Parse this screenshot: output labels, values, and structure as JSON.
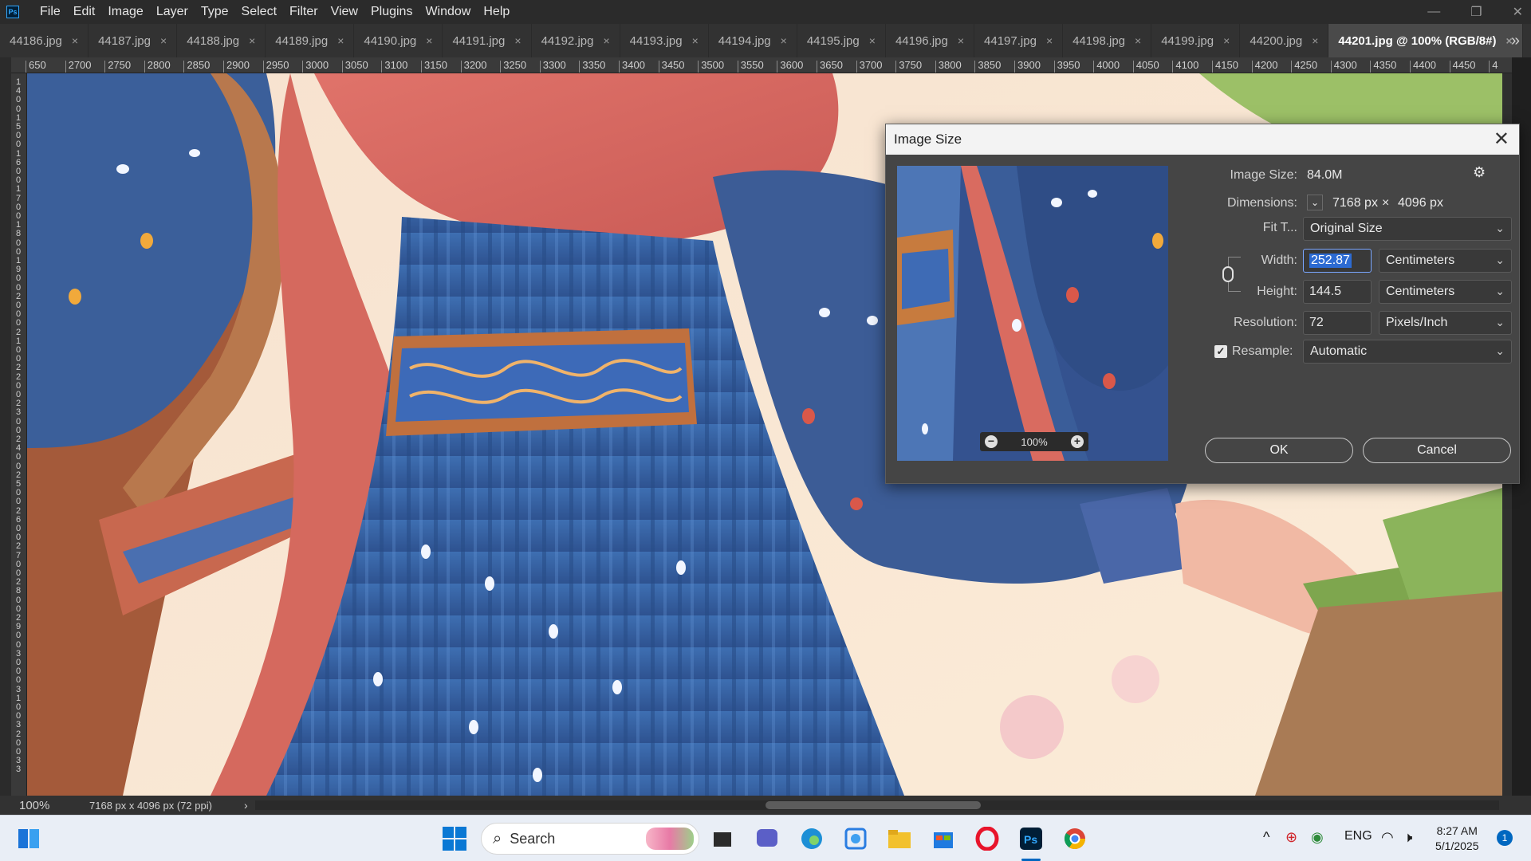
{
  "app": {
    "logo": "Ps"
  },
  "menu": [
    "File",
    "Edit",
    "Image",
    "Layer",
    "Type",
    "Select",
    "Filter",
    "View",
    "Plugins",
    "Window",
    "Help"
  ],
  "window_controls": {
    "minimize": "—",
    "restore": "❐",
    "close": "✕"
  },
  "tabs": [
    {
      "label": "44186.jpg",
      "active": false
    },
    {
      "label": "44187.jpg",
      "active": false
    },
    {
      "label": "44188.jpg",
      "active": false
    },
    {
      "label": "44189.jpg",
      "active": false
    },
    {
      "label": "44190.jpg",
      "active": false
    },
    {
      "label": "44191.jpg",
      "active": false
    },
    {
      "label": "44192.jpg",
      "active": false
    },
    {
      "label": "44193.jpg",
      "active": false
    },
    {
      "label": "44194.jpg",
      "active": false
    },
    {
      "label": "44195.jpg",
      "active": false
    },
    {
      "label": "44196.jpg",
      "active": false
    },
    {
      "label": "44197.jpg",
      "active": false
    },
    {
      "label": "44198.jpg",
      "active": false
    },
    {
      "label": "44199.jpg",
      "active": false
    },
    {
      "label": "44200.jpg",
      "active": false
    },
    {
      "label": "44201.jpg @ 100% (RGB/8#)",
      "active": true
    }
  ],
  "tab_close_glyph": "×",
  "tab_overflow": "»",
  "ruler": {
    "h_ticks": [
      "650",
      "2700",
      "2750",
      "2800",
      "2850",
      "2900",
      "2950",
      "3000",
      "3050",
      "3100",
      "3150",
      "3200",
      "3250",
      "3300",
      "3350",
      "3400",
      "3450",
      "3500",
      "3550",
      "3600",
      "3650",
      "3700",
      "3750",
      "3800",
      "3850",
      "3900",
      "3950",
      "4000",
      "4050",
      "4100",
      "4150",
      "4200",
      "4250",
      "4300",
      "4350",
      "4400",
      "4450",
      "4"
    ],
    "v_ticks": [
      "1",
      "4",
      "0",
      "0",
      "1",
      "5",
      "0",
      "0",
      "1",
      "6",
      "0",
      "0",
      "1",
      "7",
      "0",
      "0",
      "1",
      "8",
      "0",
      "0",
      "1",
      "9",
      "0",
      "0",
      "2",
      "0",
      "0",
      "0",
      "2",
      "1",
      "0",
      "0",
      "2",
      "2",
      "0",
      "0",
      "2",
      "3",
      "0",
      "0",
      "2",
      "4",
      "0",
      "0",
      "2",
      "5",
      "0",
      "0",
      "2",
      "6",
      "0",
      "0",
      "2",
      "7",
      "0",
      "0",
      "2",
      "8",
      "0",
      "0",
      "2",
      "9",
      "0",
      "0",
      "3",
      "0",
      "0",
      "0",
      "3",
      "1",
      "0",
      "0",
      "3",
      "2",
      "0",
      "0",
      "3",
      "3"
    ]
  },
  "status": {
    "zoom": "100%",
    "doc_info": "7168 px x 4096 px (72 ppi)",
    "arrow": "›",
    "scroll_left": "‹"
  },
  "dialog": {
    "title": "Image Size",
    "close": "✕",
    "image_size_label": "Image Size:",
    "image_size_value": "84.0M",
    "settings_icon": "⚙",
    "dimensions_label": "Dimensions:",
    "dimensions_width": "7168 px",
    "dimensions_times": "×",
    "dimensions_height": "4096 px",
    "fit_label": "Fit T...",
    "fit_value": "Original Size",
    "width_label": "Width:",
    "width_value": "252.87",
    "width_unit": "Centimeters",
    "height_label": "Height:",
    "height_value": "144.5",
    "height_unit": "Centimeters",
    "resolution_label": "Resolution:",
    "resolution_value": "72",
    "resolution_unit": "Pixels/Inch",
    "resample_label": "Resample:",
    "resample_checked": true,
    "resample_value": "Automatic",
    "preview_zoom": "100%",
    "ok": "OK",
    "cancel": "Cancel"
  },
  "taskbar": {
    "search_placeholder": "Search",
    "tray": {
      "lang": "ENG",
      "caret": "^"
    },
    "clock_time": "8:27 AM",
    "clock_date": "5/1/2025",
    "notifications": "1"
  },
  "colors": {
    "accent": "#31a8ff",
    "selection": "#2d6bd2",
    "dialog_bg": "#454545",
    "taskbar_bg": "#e9eef6"
  }
}
